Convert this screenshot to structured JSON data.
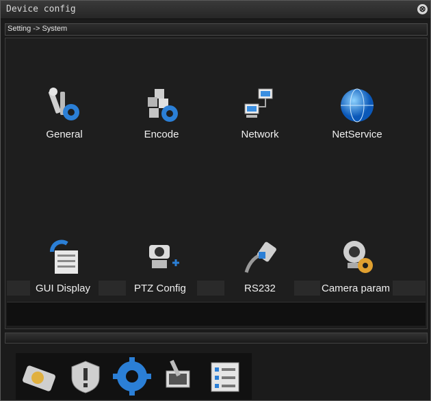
{
  "window": {
    "title": "Device config",
    "close_glyph": "⊗"
  },
  "breadcrumb": "Setting -> System",
  "items": [
    {
      "label": "General",
      "icon": "tools-gear-icon"
    },
    {
      "label": "Encode",
      "icon": "cubes-gear-icon"
    },
    {
      "label": "Network",
      "icon": "network-computers-icon"
    },
    {
      "label": "NetService",
      "icon": "globe-icon"
    },
    {
      "label": "GUI Display",
      "icon": "display-refresh-icon"
    },
    {
      "label": "PTZ Config",
      "icon": "ptz-camera-icon"
    },
    {
      "label": "RS232",
      "icon": "serial-cable-icon"
    },
    {
      "label": "Camera param",
      "icon": "webcam-gear-icon"
    }
  ],
  "dock": [
    {
      "icon": "hard-disk-icon"
    },
    {
      "icon": "alert-shield-icon"
    },
    {
      "icon": "settings-gear-icon",
      "active": true
    },
    {
      "icon": "tools-monitor-icon"
    },
    {
      "icon": "checklist-icon"
    }
  ],
  "colors": {
    "accent": "#2b7fd6",
    "panel": "#1e1e1e",
    "text": "#f0f0f0"
  }
}
